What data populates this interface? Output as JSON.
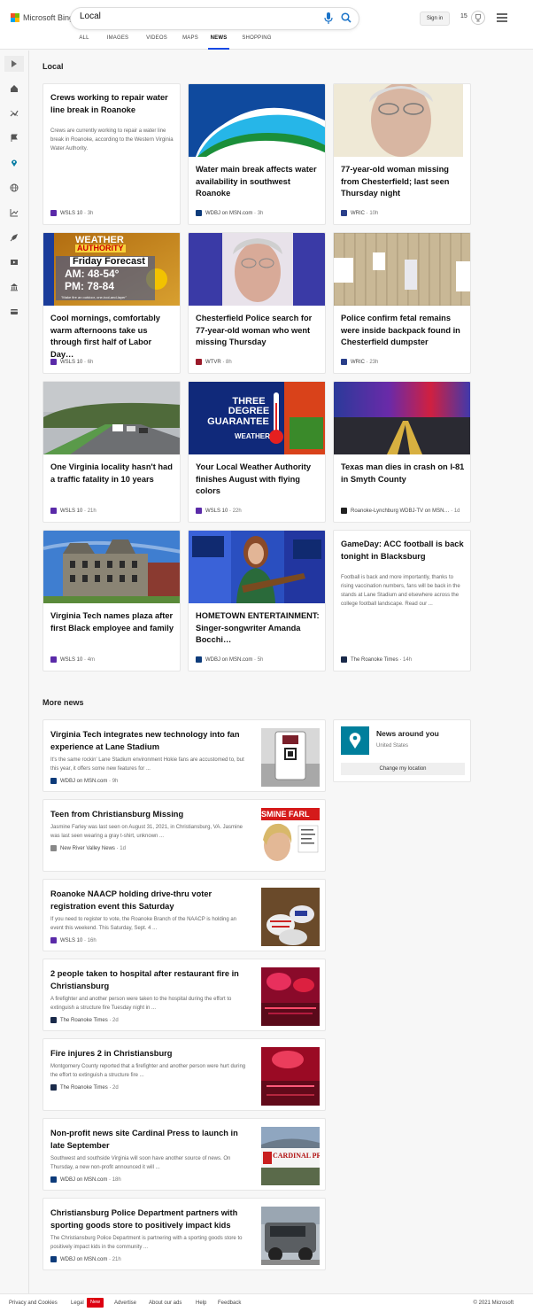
{
  "header": {
    "logo_text": "Microsoft Bing",
    "search_value": "Local",
    "signin_label": "Sign in",
    "rewards_count": "15",
    "tabs": [
      {
        "label": "ALL"
      },
      {
        "label": "IMAGES"
      },
      {
        "label": "VIDEOS"
      },
      {
        "label": "MAPS"
      },
      {
        "label": "NEWS"
      },
      {
        "label": "SHOPPING"
      }
    ],
    "active_tab": "NEWS",
    "accent_color": "#174ae4"
  },
  "rail": {
    "icons": [
      "expand-icon",
      "home-icon",
      "trending-icon",
      "flag-icon",
      "location-icon",
      "globe-icon",
      "chart-icon",
      "rocket-icon",
      "video-icon",
      "building-icon",
      "card-icon"
    ]
  },
  "main": {
    "section_title": "Local",
    "cards": [
      {
        "title": "Crews working to repair water line break in Roanoke",
        "snippet": "Crews are currently working to repair a water line break in Roanoke, according to the Western Virginia Water Authority.",
        "source": "WSLS 10",
        "age": "3h"
      },
      {
        "title": "Water main break affects water availability in southwest Roanoke",
        "source": "WDBJ on MSN.com",
        "age": "3h"
      },
      {
        "title": "77-year-old woman missing from Chesterfield; last seen Thursday night",
        "source": "WRIC",
        "age": "10h"
      },
      {
        "title": "Cool mornings, comfortably warm afternoons take us through first half of Labor Day…",
        "source": "WSLS 10",
        "age": "6h",
        "thumb_text": {
          "brand1": "WEATHER",
          "brand2": "AUTHORITY",
          "line1": "Friday Forecast",
          "line2": "AM: 48-54°",
          "line3": "PM: 78-84",
          "footer": "\"Make fire an outdoor, one-tool-and-layer\""
        }
      },
      {
        "title": "Chesterfield Police search for 77-year-old woman who went missing Thursday",
        "source": "WTVR",
        "age": "8h"
      },
      {
        "title": "Police confirm fetal remains were inside backpack found in Chesterfield dumpster",
        "source": "WRIC",
        "age": "23h"
      },
      {
        "title": "One Virginia locality hasn't had a traffic fatality in 10 years",
        "source": "WSLS 10",
        "age": "21h"
      },
      {
        "title": "Your Local Weather Authority finishes August with flying colors",
        "source": "WSLS 10",
        "age": "22h",
        "thumb_text": {
          "line1": "THREE",
          "line2": "DEGREE",
          "line3": "GUARANTEE",
          "brand": "WEATHER"
        }
      },
      {
        "title": "Texas man dies in crash on I-81 in Smyth County",
        "source": "Roanoke-Lynchburg WDBJ-TV on MSN…",
        "age": "1d"
      },
      {
        "title": "Virginia Tech names plaza after first Black employee and family",
        "source": "WSLS 10",
        "age": "4m"
      },
      {
        "title": "HOMETOWN ENTERTAINMENT: Singer-songwriter Amanda Bocchi…",
        "source": "WDBJ on MSN.com",
        "age": "5h"
      },
      {
        "title": "GameDay: ACC football is back tonight in Blacksburg",
        "snippet": "Football is back and more importantly, thanks to rising vaccination numbers, fans will be back in the stands at Lane Stadium and elsewhere across the college football landscape. Read our ...",
        "source": "The Roanoke Times",
        "age": "14h"
      }
    ],
    "more_news_title": "More news",
    "more_news": [
      {
        "title": "Virginia Tech integrates new technology into fan experience at Lane Stadium",
        "snippet": "It's the same rockin' Lane Stadium environment Hokie fans are accustomed to, but this year, it offers some new features for ...",
        "source": "WDBJ on MSN.com",
        "age": "9h"
      },
      {
        "title": "Teen from Christiansburg Missing",
        "snippet": "Jasmine Farley was last seen on August 31, 2021, in Christiansburg, VA. Jasmine was last seen wearing a gray t-shirt, unknown ...",
        "source": "New River Valley News",
        "age": "1d",
        "thumb_text": "SMINE FARL"
      },
      {
        "title": "Roanoke NAACP holding drive-thru voter registration event this Saturday",
        "snippet": "If you need to register to vote, the Roanoke Branch of the NAACP is holding an event this weekend. This Saturday, Sept. 4 ...",
        "source": "WSLS 10",
        "age": "16h"
      },
      {
        "title": "2 people taken to hospital after restaurant fire in Christiansburg",
        "snippet": "A firefighter and another person were taken to the hospital during the effort to extinguish a structure fire Tuesday night in ...",
        "source": "The Roanoke Times",
        "age": "2d"
      },
      {
        "title": "Fire injures 2 in Christiansburg",
        "snippet": "Montgomery County reported that a firefighter and another person were hurt during the effort to extinguish a structure fire ...",
        "source": "The Roanoke Times",
        "age": "2d"
      },
      {
        "title": "Non-profit news site Cardinal Press to launch in late September",
        "snippet": "Southwest and southside Virginia will soon have another source of news. On Thursday, a new non-profit announced it will ...",
        "source": "WDBJ on MSN.com",
        "age": "18h",
        "thumb_text": "CARDINAL PRE"
      },
      {
        "title": "Christiansburg Police Department partners with sporting goods store to positively impact kids",
        "snippet": "The Christiansburg Police Department is partnering with a sporting goods store to positively impact kids in the community ...",
        "source": "WDBJ on MSN.com",
        "age": "21h"
      }
    ]
  },
  "aside": {
    "title": "News around you",
    "subtitle": "United States",
    "button_label": "Change my location"
  },
  "footer": {
    "privacy": "Privacy and Cookies",
    "legal": "Legal",
    "new_badge": "New",
    "advertise": "Advertise",
    "about_ads": "About our ads",
    "help": "Help",
    "feedback": "Feedback",
    "copyright": "© 2021 Microsoft"
  }
}
